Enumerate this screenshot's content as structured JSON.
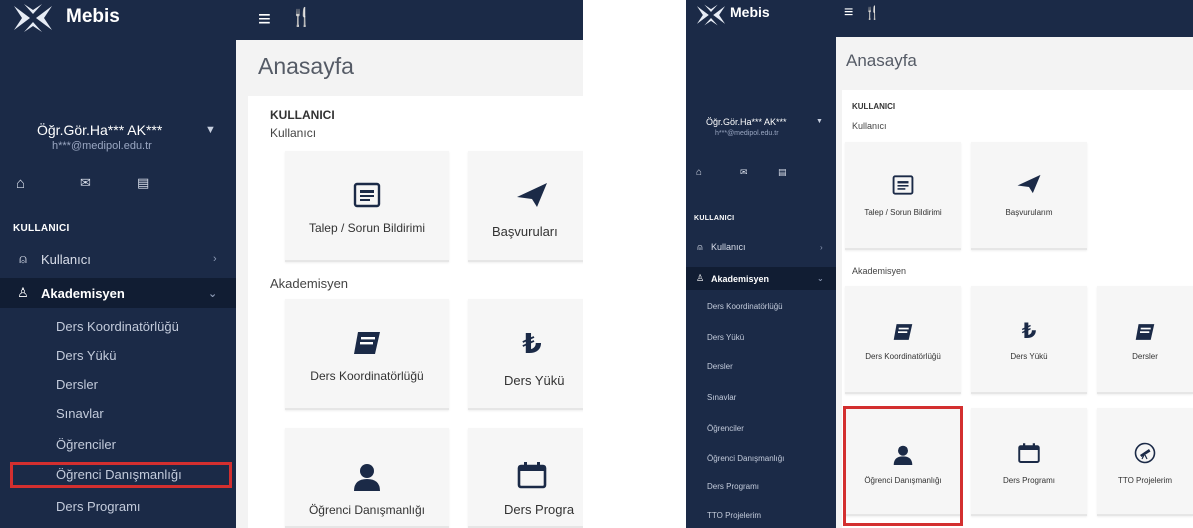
{
  "app": {
    "brand": "Mebis"
  },
  "user": {
    "name": "Öğr.Gör.Ha*** AK***",
    "email": "h***@medipol.edu.tr"
  },
  "sidebar": {
    "section": "KULLANICI",
    "kullanici": "Kullanıcı",
    "akademisyen": "Akademisyen",
    "submenu": [
      "Ders Koordinatörlüğü",
      "Ders Yükü",
      "Dersler",
      "Sınavlar",
      "Öğrenciler",
      "Öğrenci Danışmanlığı",
      "Ders Programı",
      "TTO Projelerim"
    ]
  },
  "main": {
    "page_title": "Anasayfa",
    "group_title": "KULLANICI",
    "group_sub": "Kullanıcı",
    "akademisyen_heading": "Akademisyen"
  },
  "cards": {
    "talep": "Talep / Sorun Bildirimi",
    "basvurularim": "Başvurularım",
    "basvurulari_cropped": "Başvuruları",
    "ders_koord": "Ders Koordinatörlüğü",
    "ders_yuku": "Ders Yükü",
    "ders_yuku_cropped": "Ders Yükü",
    "dersler": "Dersler",
    "ogrenci_dan": "Öğrenci Danışmanlığı",
    "ders_programi": "Ders Programı",
    "ders_progra_cropped": "Ders Progra",
    "tto": "TTO Projelerim"
  },
  "colors": {
    "navy": "#1b2a47",
    "active": "#111d33",
    "highlight": "#d32f2f"
  }
}
